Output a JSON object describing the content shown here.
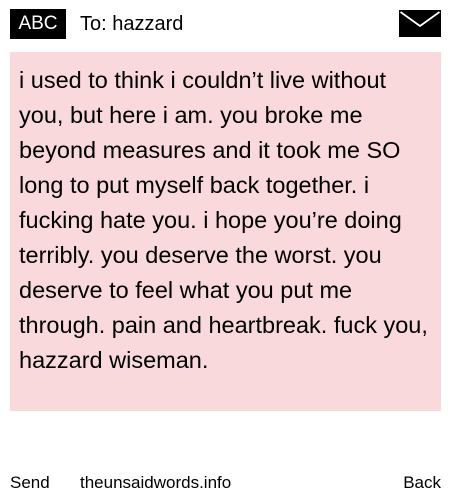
{
  "header": {
    "badge": "ABC",
    "to_prefix": "To:",
    "recipient": "hazzard",
    "envelope_icon": "envelope-icon"
  },
  "message": {
    "body": "i used to think i couldn’t live without you, but here i am. you broke me beyond measures and it took me SO long to put myself back together. i fucking hate you. i hope you’re doing terribly. you deserve the worst. you deserve to feel what you put me through. pain and heartbreak. fuck you, hazzard wiseman.",
    "background": "#f9d9dc"
  },
  "footer": {
    "send_label": "Send",
    "site": "theunsaidwords.info",
    "back_label": "Back"
  }
}
